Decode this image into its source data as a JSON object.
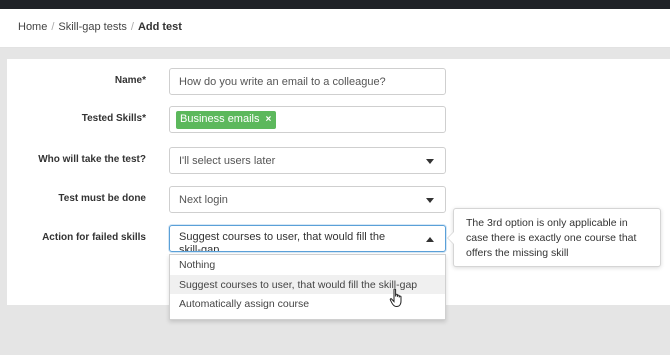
{
  "breadcrumb": {
    "items": [
      "Home",
      "Skill-gap tests"
    ],
    "separator": "/",
    "current": "Add test"
  },
  "form": {
    "name": {
      "label": "Name*",
      "value": "How do you write an email to a colleague?"
    },
    "tested_skills": {
      "label": "Tested Skills*",
      "tags": [
        "Business emails"
      ],
      "remove_glyph": "×"
    },
    "who_takes": {
      "label": "Who will take the test?",
      "value": "I'll select users later"
    },
    "must_be_done": {
      "label": "Test must be done",
      "value": "Next login"
    },
    "failed_action": {
      "label": "Action for failed skills",
      "value": "Suggest courses to user, that would fill the skill-gap",
      "options": [
        "Nothing",
        "Suggest courses to user, that would fill the skill-gap",
        "Automatically assign course"
      ],
      "hovered_option": 1
    }
  },
  "tooltip": {
    "text": "The 3rd option is only applicable in case there is exactly one course that offers the missing skill"
  },
  "colors": {
    "tag": "#5cb85c",
    "focus": "#5aa0d8",
    "topbar": "#1f2227",
    "background": "#e5e5e5"
  },
  "icons": [
    "caret-down-icon",
    "caret-up-icon",
    "remove-tag-icon",
    "hand-pointer-cursor"
  ]
}
